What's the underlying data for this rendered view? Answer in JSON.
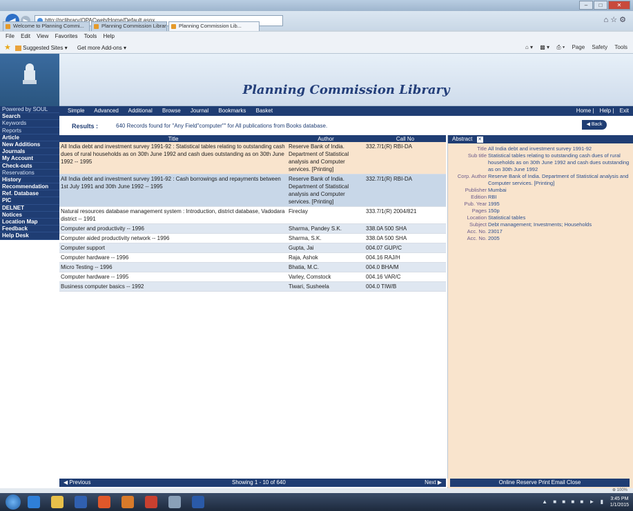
{
  "browser": {
    "address": "http://pclibrary/OPACweb/Home/Default.aspx",
    "tabs": [
      "Welcome to Planning Commi...",
      "Planning Commission Library",
      "Planning Commission Lib..."
    ],
    "menu": [
      "File",
      "Edit",
      "View",
      "Favorites",
      "Tools",
      "Help"
    ],
    "favorites": [
      "Suggested Sites",
      "Get more Add-ons"
    ],
    "commands": [
      "Page",
      "Safety",
      "Tools"
    ],
    "zoom": "⊕ 100%",
    "window_buttons": [
      "–",
      "□",
      "✕"
    ]
  },
  "sidebar": {
    "items": [
      "Powered by SOUL",
      "Search",
      "Keywords",
      "Reports",
      "Article",
      "New Additions",
      "Journals",
      "My Account",
      "Check-outs",
      "Reservations",
      "History",
      "Recommendation",
      "Ref. Database",
      "PIC",
      "DELNET",
      "Notices",
      "Location Map",
      "Feedback",
      "Help Desk"
    ]
  },
  "header": {
    "title": "Planning Commission Library"
  },
  "tabsbar": {
    "left": [
      "Simple",
      "Advanced",
      "Additional",
      "Browse",
      "Journal",
      "Bookmarks",
      "Basket"
    ],
    "right": [
      "Home",
      "Help",
      "Exit"
    ]
  },
  "results": {
    "label": "Results :",
    "text": "640 Records found for \"Any Field\"computer\"\" for All publications from Books database.",
    "back_label": "Back"
  },
  "table": {
    "headers": [
      "Title",
      "Author",
      "Call No"
    ],
    "rows": [
      {
        "title": "All India debt and investment survey 1991-92 : Statistical tables relating to outstanding cash dues of rural households as on 30th June 1992 and cash dues outstanding as on 30th June 1992 -- 1995",
        "author": "Reserve Bank of India. Department of Statistical analysis and Computer services. [Printing]",
        "call": "332.7/1(R) RBI-DA",
        "style": "r-peach"
      },
      {
        "title": "All India debt and investment survey 1991-92 : Cash borrowings and repayments between 1st July 1991 and 30th June 1992 -- 1995",
        "author": "Reserve Bank of India. Department of Statistical analysis and Computer services. [Printing]",
        "call": "332.7/1(R) RBI-DA",
        "style": "r-blue"
      },
      {
        "title": "Natural resources database management system : Introduction, district database, Vadodara district -- 1991",
        "author": "Fireclay",
        "call": "333.7/1(R) 2004/821",
        "style": "r-white"
      },
      {
        "title": "Computer and productivity -- 1996",
        "author": "Sharma, Pandey S.K.",
        "call": "338.0A 500 SHA",
        "style": "r-light"
      },
      {
        "title": "Computer aided productivity network -- 1996",
        "author": "Sharma, S.K.",
        "call": "338.0A 500 SHA",
        "style": "r-white"
      },
      {
        "title": "Computer support",
        "author": "Gupta, Jai",
        "call": "004.07 GUP/C",
        "style": "r-light"
      },
      {
        "title": "Computer hardware -- 1996",
        "author": "Raja, Ashok",
        "call": "004.16 RAJ/H",
        "style": "r-white"
      },
      {
        "title": "Micro Testing -- 1996",
        "author": "Bhatia, M.C.",
        "call": "004.0 BHA/M",
        "style": "r-light"
      },
      {
        "title": "Computer hardware -- 1995",
        "author": "Varley, Comstock",
        "call": "004.16 VAR/C",
        "style": "r-white"
      },
      {
        "title": "Business computer basics -- 1992",
        "author": "Tiwari, Susheela",
        "call": "004.0 TIW/B",
        "style": "r-light"
      }
    ]
  },
  "detail": {
    "header": "Abstract",
    "close_icon": "✕",
    "fields": [
      {
        "k": "Title",
        "v": "All India debt and investment survey 1991-92"
      },
      {
        "k": "Sub title",
        "v": "Statistical tables relating to outstanding cash dues of rural households as on 30th June 1992 and cash dues outstanding as on 30th June 1992"
      },
      {
        "k": "Corp. Author",
        "v": "Reserve Bank of India. Department of Statistical analysis and Computer services. [Printing]"
      },
      {
        "k": "Publisher",
        "v": "Mumbai"
      },
      {
        "k": "Edition",
        "v": "RBI"
      },
      {
        "k": "Pub. Year",
        "v": "1995"
      },
      {
        "k": "Pages",
        "v": "150p"
      },
      {
        "k": "Location",
        "v": "Statistical tables"
      },
      {
        "k": "Subject",
        "v": "Debt management; Investments; Households"
      },
      {
        "k": "Acc. No.",
        "v": "23017"
      },
      {
        "k": "Acc. No.",
        "v": "2005"
      }
    ]
  },
  "pager": {
    "prev": "Previous",
    "info": "Showing 1 - 10 of 640",
    "next": "Next"
  },
  "detail_footer": "Online Reserve   Print   Email   Close",
  "taskbar": {
    "clock_time": "3:45 PM",
    "clock_date": "1/1/2015"
  }
}
